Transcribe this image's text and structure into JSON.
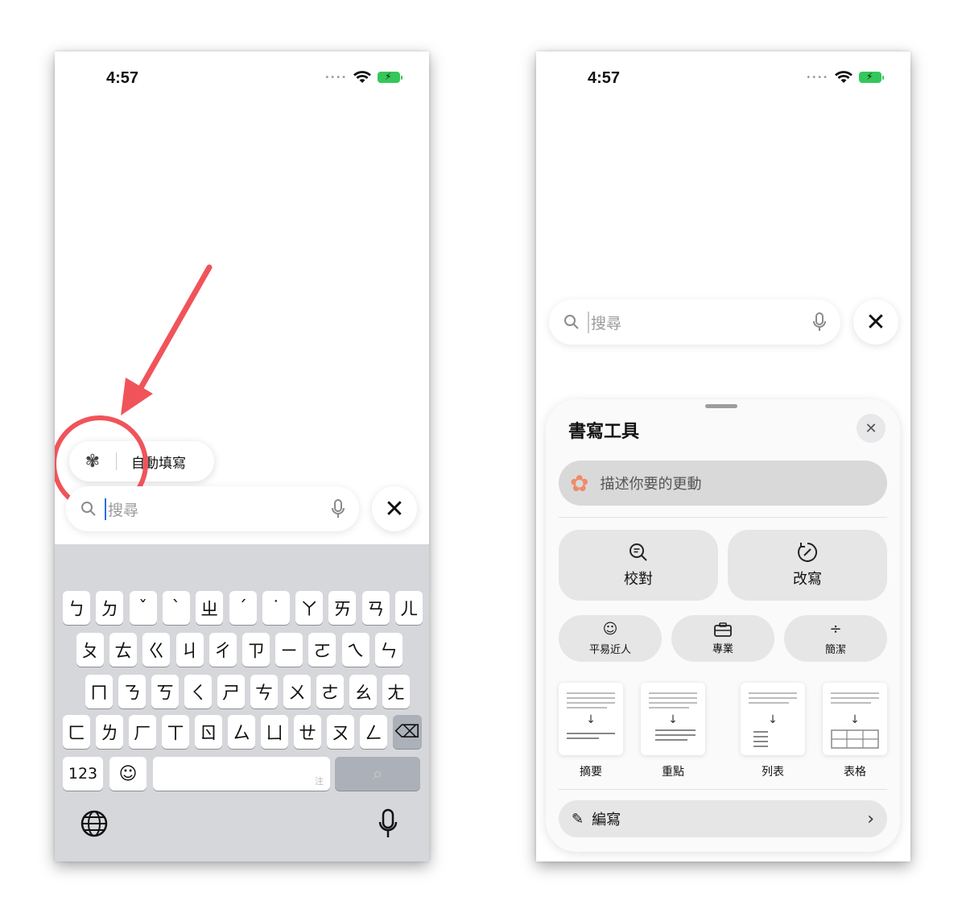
{
  "left_phone": {
    "status": {
      "time": "4:57"
    },
    "autofill": {
      "label": "自動填寫",
      "icon": "sparkle-ai-icon"
    },
    "search": {
      "placeholder": "搜尋"
    },
    "keyboard": {
      "row1": [
        "ㄅ",
        "ㄉ",
        "ˇ",
        "ˋ",
        "ㄓ",
        "ˊ",
        "˙",
        "ㄚ",
        "ㄞ",
        "ㄢ",
        "ㄦ"
      ],
      "row2": [
        "ㄆ",
        "ㄊ",
        "ㄍ",
        "ㄐ",
        "ㄔ",
        "ㄗ",
        "ㄧ",
        "ㄛ",
        "ㄟ",
        "ㄣ"
      ],
      "row3": [
        "ㄇ",
        "ㄋ",
        "ㄎ",
        "ㄑ",
        "ㄕ",
        "ㄘ",
        "ㄨ",
        "ㄜ",
        "ㄠ",
        "ㄤ"
      ],
      "row4": [
        "ㄈ",
        "ㄌ",
        "ㄏ",
        "ㄒ",
        "ㄖ",
        "ㄙ",
        "ㄩ",
        "ㄝ",
        "ㄡ",
        "ㄥ"
      ],
      "numbers_key": "123",
      "space_hint": "注"
    },
    "annotation_color": "#f0545a"
  },
  "right_phone": {
    "status": {
      "time": "4:57"
    },
    "search": {
      "placeholder": "搜尋"
    },
    "sheet": {
      "title": "書寫工具",
      "describe_placeholder": "描述你要的更動",
      "proofread": "校對",
      "rewrite": "改寫",
      "friendly": "平易近人",
      "professional": "專業",
      "concise": "簡潔",
      "summary": "摘要",
      "key_points": "重點",
      "list": "列表",
      "table": "表格",
      "compose": "編寫"
    }
  }
}
